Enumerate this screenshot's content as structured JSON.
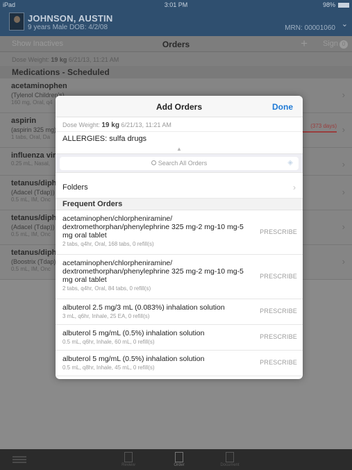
{
  "status_bar": {
    "device": "iPad",
    "wifi_icon": "wifi-icon",
    "time": "3:01 PM",
    "battery": "98%"
  },
  "patient": {
    "name": "JOHNSON, AUSTIN",
    "demographics": "9 years  Male  DOB: 4/2/08",
    "mrn": "MRN: 00001060"
  },
  "toolbar": {
    "show_inactives": "Show Inactives",
    "title": "Orders",
    "add": "+",
    "sign": "Sign",
    "sign_count": "0"
  },
  "background": {
    "dose_label": "Dose Weight:",
    "dose_value": "19 kg",
    "dose_date": "6/21/13, 11:21 AM",
    "section": "Medications - Scheduled",
    "items": [
      {
        "name": "acetaminophen",
        "sub": "(Tylenol Children's)",
        "detail": "160 mg, Oral, q4",
        "flag": ""
      },
      {
        "name": "aspirin",
        "sub": "(aspirin 325 mg)",
        "detail": "1 tabs, Oral, Da",
        "flag": "(373 days)"
      },
      {
        "name": "influenza viru",
        "sub": "",
        "detail": "0.25 mL, Nasal,",
        "flag": ""
      },
      {
        "name": "tetanus/diph",
        "sub": "(Adacel (Tdap))",
        "detail": "0.5 mL, IM, Onc",
        "flag": ""
      },
      {
        "name": "tetanus/diph",
        "sub": "(Adacel (Tdap))",
        "detail": "0.5 mL, IM, Onc",
        "flag": ""
      },
      {
        "name": "tetanus/diph",
        "sub": "(Boostrix (Tdap))",
        "detail": "0.5 mL, IM, Onc",
        "flag": ""
      }
    ]
  },
  "modal": {
    "title": "Add Orders",
    "done": "Done",
    "dose_label": "Dose Weight:",
    "dose_value": "19 kg",
    "dose_date": "6/21/13, 11:21 AM",
    "allergies": "ALLERGIES: sulfa drugs",
    "search_placeholder": "Search All Orders",
    "folders": "Folders",
    "frequent_header": "Frequent Orders",
    "prescribe_label": "PRESCRIBE",
    "orders": [
      {
        "name": "acetaminophen/chlorpheniramine/ dextromethorphan/phenylephrine 325 mg-2 mg-10 mg-5 mg oral tablet",
        "detail": "2 tabs, q4hr, Oral, 168 tabs, 0 refill(s)"
      },
      {
        "name": "acetaminophen/chlorpheniramine/ dextromethorphan/phenylephrine 325 mg-2 mg-10 mg-5 mg oral tablet",
        "detail": "2 tabs, q4hr, Oral, 84 tabs, 0 refill(s)"
      },
      {
        "name": "albuterol 2.5 mg/3 mL (0.083%) inhalation solution",
        "detail": "3 mL, q6hr, Inhale, 25 EA, 0 refill(s)"
      },
      {
        "name": "albuterol 5 mg/mL (0.5%) inhalation solution",
        "detail": "0.5 mL, q6hr, Inhale, 60 mL, 0 refill(s)"
      },
      {
        "name": "albuterol 5 mg/mL (0.5%) inhalation solution",
        "detail": "0.5 mL, q8hr, Inhale, 45 mL, 0 refill(s)"
      }
    ]
  },
  "tabbar": {
    "tabs": [
      "Review",
      "Order",
      "Document"
    ]
  },
  "colors": {
    "accent": "#1f7ad6",
    "header": "#2f4f6f",
    "overlay": "#8a8a8a",
    "tabbar": "#2b2b2b"
  }
}
